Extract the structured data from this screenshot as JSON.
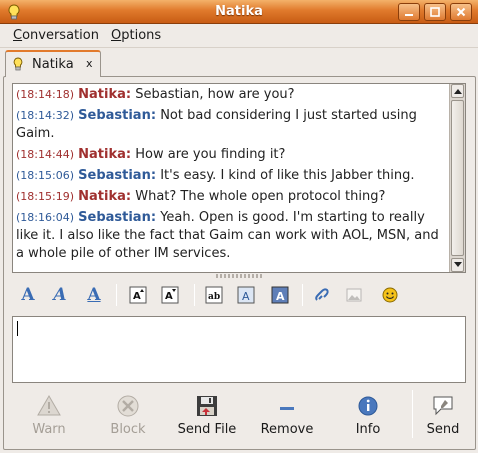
{
  "window": {
    "title": "Natika"
  },
  "menubar": {
    "items": [
      {
        "label": "Conversation",
        "mnemonic": "C",
        "rest": "onversation"
      },
      {
        "label": "Options",
        "mnemonic": "O",
        "rest": "ptions"
      }
    ]
  },
  "tab": {
    "label": "Natika",
    "close": "x"
  },
  "messages": [
    {
      "time": "(18:14:18)",
      "nick": "Natika:",
      "text": "Sebastian, how are you?",
      "side": "red"
    },
    {
      "time": "(18:14:32)",
      "nick": "Sebastian:",
      "text": "Not bad considering I just started using Gaim.",
      "side": "blue"
    },
    {
      "time": "(18:14:44)",
      "nick": "Natika:",
      "text": "How are you finding it?",
      "side": "red"
    },
    {
      "time": "(18:15:06)",
      "nick": "Sebastian:",
      "text": "It's easy. I kind of like this Jabber thing.",
      "side": "blue"
    },
    {
      "time": "(18:15:19)",
      "nick": "Natika:",
      "text": "What? The whole open protocol thing?",
      "side": "red"
    },
    {
      "time": "(18:16:04)",
      "nick": "Sebastian:",
      "text": "Yeah. Open is good. I'm starting to really like it. I also like the fact that Gaim can work with AOL, MSN, and a whole pile of other IM services.",
      "side": "blue"
    }
  ],
  "toolbar": {
    "bold_glyph": "A",
    "italic_glyph": "A",
    "underline_glyph": "A",
    "larger_glyph": "A",
    "smaller_glyph": "A",
    "font_glyph": "ab",
    "fg_glyph": "A",
    "bg_glyph": "A"
  },
  "entry": {
    "value": ""
  },
  "buttons": {
    "warn": "Warn",
    "block": "Block",
    "send_file": "Send File",
    "remove": "Remove",
    "info": "Info",
    "send": "Send"
  },
  "colors": {
    "titlebar": "#e07a2c",
    "nick_self": "#a0302f",
    "nick_other": "#2f5a98"
  }
}
